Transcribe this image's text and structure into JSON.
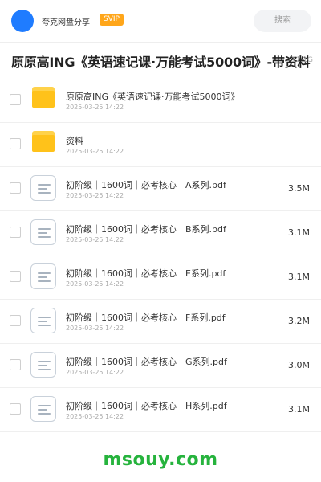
{
  "header": {
    "brand": "夸克网盘分享",
    "badge": "SVIP",
    "search_placeholder": "搜索"
  },
  "share": {
    "title": "原原高ING《英语速记课·万能考试5000词》-带资料",
    "total_size": "11.1G"
  },
  "files": [
    {
      "type": "folder",
      "name": "原原高ING《英语速记课·万能考试5000词》",
      "date": "2025-03-25 14:22",
      "size": ""
    },
    {
      "type": "folder",
      "name": "资料",
      "date": "2025-03-25 14:22",
      "size": ""
    },
    {
      "type": "file",
      "name": "初阶级｜1600词｜必考核心｜A系列.pdf",
      "date": "2025-03-25 14:22",
      "size": "3.5M"
    },
    {
      "type": "file",
      "name": "初阶级｜1600词｜必考核心｜B系列.pdf",
      "date": "2025-03-25 14:22",
      "size": "3.1M"
    },
    {
      "type": "file",
      "name": "初阶级｜1600词｜必考核心｜E系列.pdf",
      "date": "2025-03-25 14:22",
      "size": "3.1M"
    },
    {
      "type": "file",
      "name": "初阶级｜1600词｜必考核心｜F系列.pdf",
      "date": "2025-03-25 14:22",
      "size": "3.2M"
    },
    {
      "type": "file",
      "name": "初阶级｜1600词｜必考核心｜G系列.pdf",
      "date": "2025-03-25 14:22",
      "size": "3.0M"
    },
    {
      "type": "file",
      "name": "初阶级｜1600词｜必考核心｜H系列.pdf",
      "date": "2025-03-25 14:22",
      "size": "3.1M"
    }
  ],
  "watermark": "msouy.com",
  "colors": {
    "accent": "#1f7cff",
    "badge": "#ffa61a",
    "folder": "#ffc21a",
    "watermark": "#26b33d"
  }
}
